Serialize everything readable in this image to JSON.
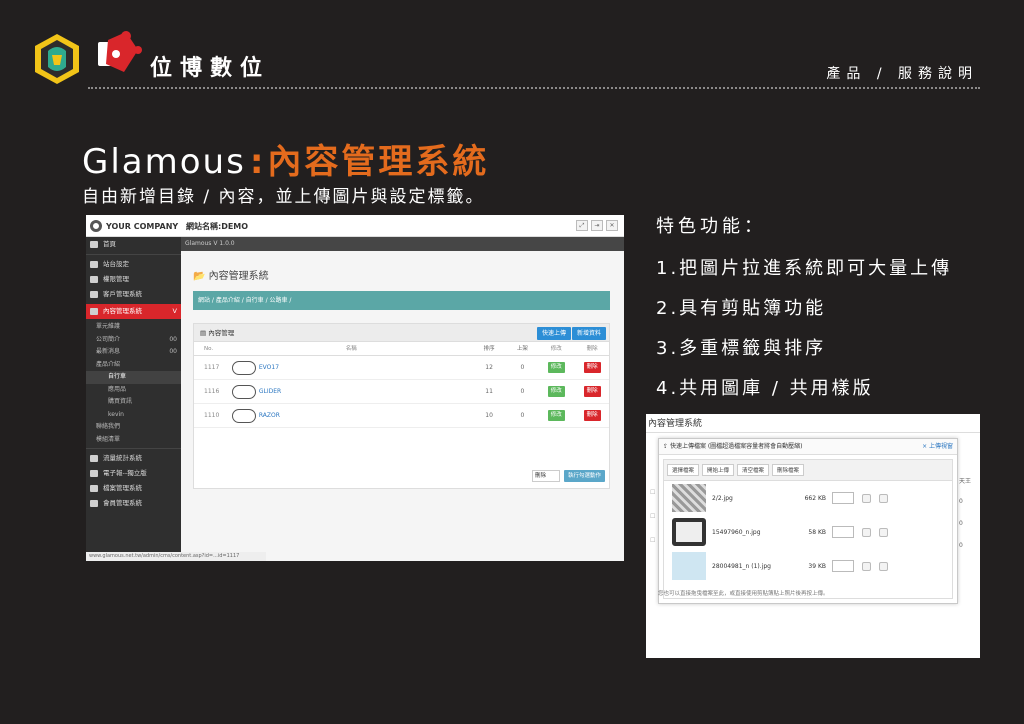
{
  "header": {
    "brand_name": "位博數位",
    "nav_label": "產品 / 服務說明",
    "colors": {
      "accent": "#e46b1d",
      "background": "#221f1f"
    },
    "icons": [
      "lion-logo-icon",
      "brand-mark-icon"
    ]
  },
  "hero": {
    "title_main": "Glamous",
    "title_colon": ":",
    "title_sub": "內容管理系統",
    "subtitle": "自由新增目錄 / 內容，並上傳圖片與設定標籤。"
  },
  "features": {
    "heading": "特色功能：",
    "items": [
      "1.把圖片拉進系統即可大量上傳",
      "2.具有剪貼簿功能",
      "3.多重標籤與排序",
      "4.共用圖庫 / 共用樣版"
    ]
  },
  "screenshot_admin": {
    "brand": "YOUR COMPANY",
    "site_name": "網站名稱:DEMO",
    "version": "Glamous V 1.0.0",
    "sidebar": {
      "items": [
        {
          "label": "首頁",
          "icon": "home-icon"
        },
        {
          "label": "站台設定",
          "icon": "monitor-icon"
        },
        {
          "label": "權限管理",
          "icon": "arrows-icon"
        },
        {
          "label": "客戶管理系統",
          "icon": "card-icon"
        },
        {
          "label": "內容管理系統",
          "icon": "edit-icon",
          "active": true,
          "badge": "V"
        }
      ],
      "sub_items": [
        {
          "label": "單元維護",
          "deep": false
        },
        {
          "label": "公司簡介",
          "deep": false,
          "count": "00"
        },
        {
          "label": "最新消息",
          "deep": false,
          "count": "00"
        },
        {
          "label": "產品介紹",
          "deep": false
        },
        {
          "label": "自行車",
          "deep": true,
          "highlight": true
        },
        {
          "label": "應用品",
          "deep": true
        },
        {
          "label": "購買資訊",
          "deep": true
        },
        {
          "label": "kevin",
          "deep": true
        },
        {
          "label": "聯絡我們",
          "deep": false
        },
        {
          "label": "模組清單",
          "deep": false
        }
      ],
      "bottom_items": [
        {
          "label": "流量統計系統",
          "icon": "chart-icon"
        },
        {
          "label": "電子報--獨立版",
          "icon": "newsletter-icon"
        },
        {
          "label": "檔案管理系統",
          "icon": "folder-icon"
        },
        {
          "label": "會員管理系統",
          "icon": "users-icon"
        }
      ]
    },
    "main": {
      "heading": "內容管理系統",
      "breadcrumb": "網站 / 產品介紹 / 自行車 / 公路車 /",
      "panel_title": "內容管理",
      "quick_upload": "快速上傳",
      "new_content": "新增資料",
      "columns": [
        "No.",
        "名稱",
        "排序",
        "上架",
        "修改",
        "刪除"
      ],
      "rows": [
        {
          "no": "1117",
          "name": "EVO17",
          "sort": "12",
          "online": "0",
          "edit": "修改",
          "del": "刪除"
        },
        {
          "no": "1116",
          "name": "GLIDER",
          "sort": "11",
          "online": "0",
          "edit": "修改",
          "del": "刪除"
        },
        {
          "no": "1110",
          "name": "RAZOR",
          "sort": "10",
          "online": "0",
          "edit": "修改",
          "del": "刪除"
        }
      ],
      "select_label": "刪除",
      "execute_label": "執行勾選動作"
    },
    "status_url": "www.glamous.net.tw/admin/cms/content.asp?id=...id=1117"
  },
  "screenshot_upload": {
    "bg_title": "內容管理系統",
    "modal_title": "快速上傳檔案 (圖檔超過檔案容量者將會自動壓縮)",
    "close_label": "× 上傳視窗",
    "tools": [
      "選擇檔案",
      "開始上傳",
      "清空檔案",
      "刪除檔案"
    ],
    "files": [
      {
        "name": "2/2.jpg",
        "size": "662 KB"
      },
      {
        "name": "15497960_n.jpg",
        "size": "58 KB"
      },
      {
        "name": "28004981_n (1).jpg",
        "size": "39 KB"
      }
    ],
    "bg_right": [
      "天王",
      "0",
      "0",
      "0"
    ],
    "hint": "您也可以直接拖曳檔案至此，或直接使用剪貼簿貼上照片後再按上傳。"
  }
}
